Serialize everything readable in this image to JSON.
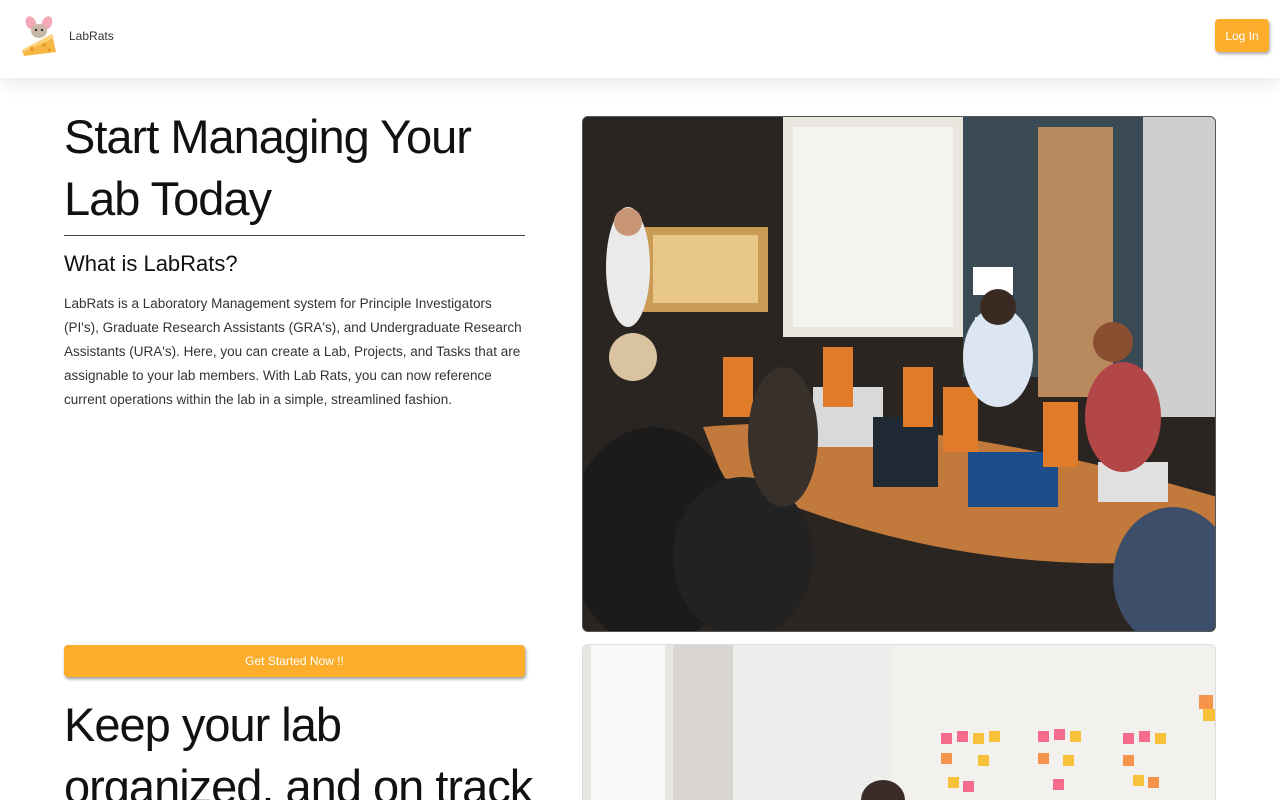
{
  "navbar": {
    "brand_name": "LabRats",
    "login_label": "Log In"
  },
  "hero": {
    "title": "Start Managing Your Lab Today",
    "about_heading": "What is LabRats?",
    "about_text": "LabRats is a Laboratory Management system for Principle Investigators (PI's), Graduate Research Assistants (GRA's), and Undergraduate Research Assistants (URA's). Here, you can create a Lab, Projects, and Tasks that are assignable to your lab members. With Lab Rats, you can now reference current operations within the lab in a simple, streamlined fashion.",
    "cta_label": "Get Started Now !!"
  },
  "section2": {
    "title": "Keep your lab organized, and on track"
  },
  "colors": {
    "accent": "#fbad2b",
    "text": "#111111"
  },
  "icons": {
    "logo": "rat-cheese-logo-icon"
  }
}
